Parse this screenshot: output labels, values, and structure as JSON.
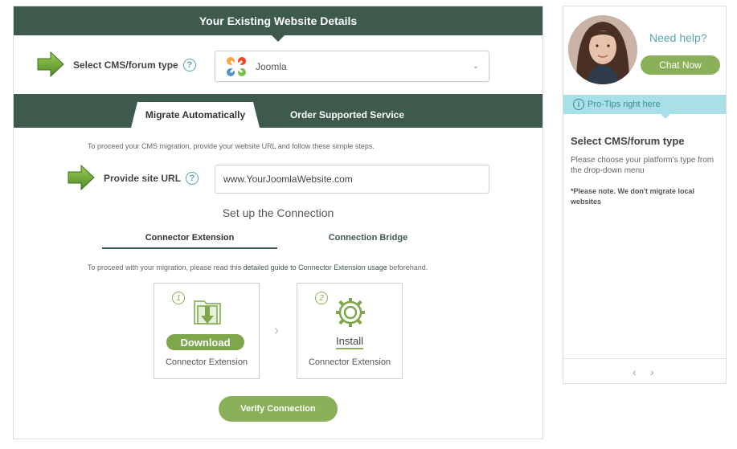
{
  "header": {
    "title": "Your Existing Website Details"
  },
  "cms": {
    "label": "Select CMS/forum type",
    "help": "?",
    "selected": "Joomla",
    "chevron": "⌄"
  },
  "tabs": [
    {
      "label": "Migrate Automatically"
    },
    {
      "label": "Order Supported Service"
    }
  ],
  "intro_note": "To proceed your CMS migration, provide your website URL and follow these simple steps.",
  "site_url": {
    "label": "Provide site URL",
    "help": "?",
    "value": "www.YourJoomlaWebsite.com"
  },
  "setup": {
    "title": "Set up the Connection",
    "subtabs": [
      {
        "label": "Connector Extension"
      },
      {
        "label": "Connection Bridge"
      }
    ],
    "note_prefix": "To proceed with your migration, please read this ",
    "note_link": "detailed guide to Connector Extension usage",
    "note_suffix": " beforehand.",
    "steps": [
      {
        "num": "1",
        "action": "Download",
        "sub": "Connector Extension"
      },
      {
        "num": "2",
        "action": "Install",
        "sub": "Connector Extension"
      }
    ],
    "separator": "›",
    "verify_label": "Verify Connection"
  },
  "sidebar": {
    "need_help": "Need help?",
    "chat_label": "Chat Now",
    "protips_label": "Pro-Tips right here",
    "protips_icon": "i",
    "tip_title": "Select CMS/forum type",
    "tip_body": "Please choose your platform's type from the drop-down menu",
    "tip_note": "*Please note. We don't migrate local websites",
    "prev": "‹",
    "next": "›"
  },
  "colors": {
    "header_green": "#3d5a4c",
    "accent_green": "#8ab05a",
    "teal": "#58a5b0",
    "tip_bg": "#a9e0e8"
  }
}
